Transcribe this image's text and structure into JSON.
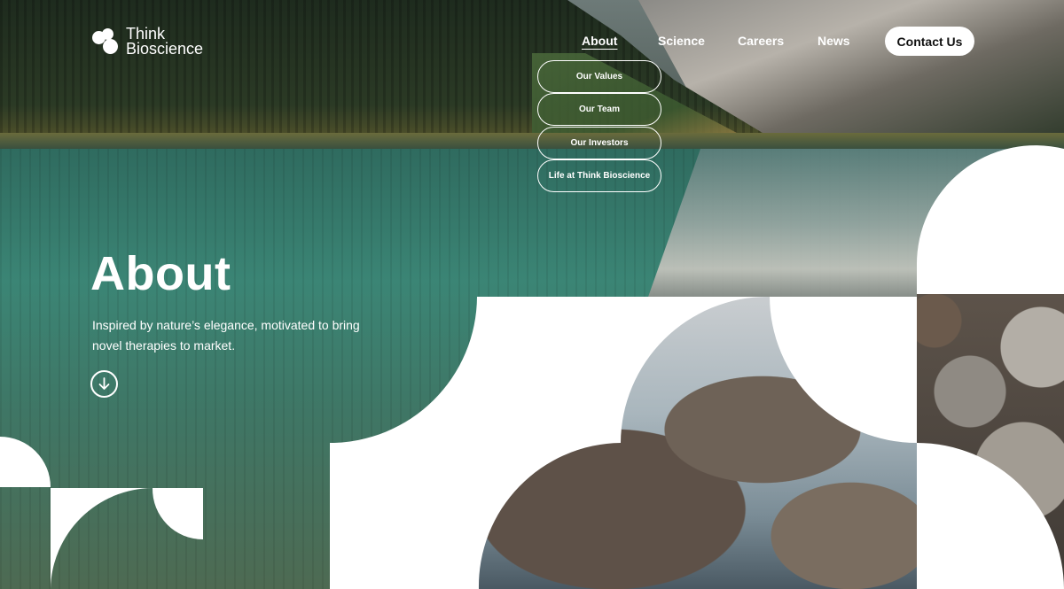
{
  "brand": {
    "line1": "Think",
    "line2": "Bioscience"
  },
  "nav": {
    "items": [
      "About",
      "Science",
      "Careers",
      "News"
    ],
    "active": "About",
    "contact_label": "Contact Us"
  },
  "about_submenu": [
    "Our Values",
    "Our Team",
    "Our Investors",
    "Life at Think Bioscience"
  ],
  "hero": {
    "title": "About",
    "subtitle": "Inspired by nature’s elegance, motivated to bring novel therapies to market."
  },
  "icons": {
    "logo": "molecule-logo-icon",
    "scroll": "arrow-down-circle-icon"
  },
  "colors": {
    "text": "#ffffff",
    "button_bg": "#ffffff",
    "button_text": "#111111"
  }
}
